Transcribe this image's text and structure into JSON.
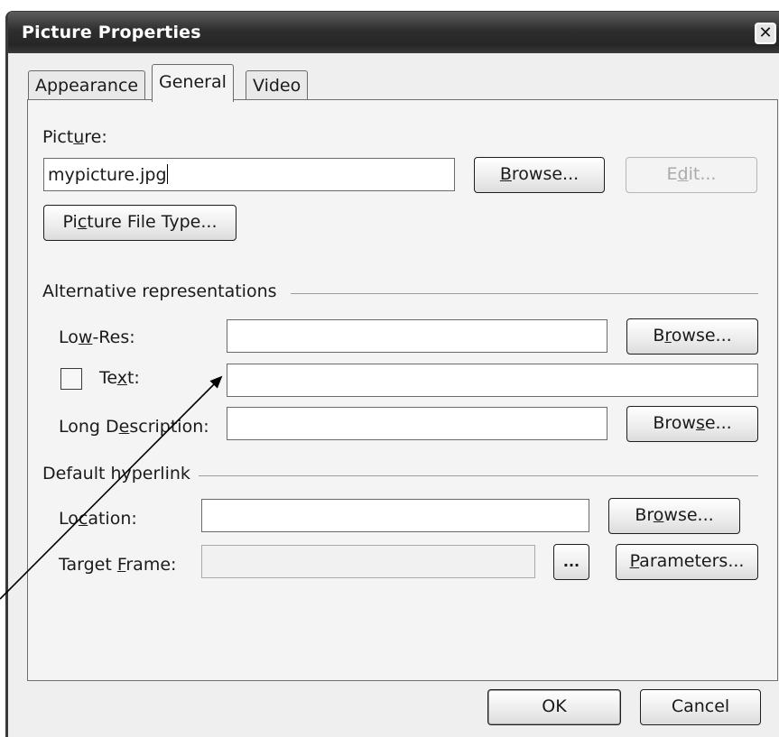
{
  "window": {
    "title": "Picture Properties"
  },
  "tabs": [
    {
      "label": "Appearance"
    },
    {
      "label": "General"
    },
    {
      "label": "Video"
    }
  ],
  "picture": {
    "label_pre": "Pict",
    "label_ul": "u",
    "label_post": "re:",
    "value": "mypicture.jpg",
    "browse_pre": "",
    "browse_ul": "B",
    "browse_post": "rowse...",
    "edit_pre": "E",
    "edit_ul": "d",
    "edit_post": "it...",
    "filetype_pre": "Pi",
    "filetype_ul": "c",
    "filetype_post": "ture File Type..."
  },
  "alt": {
    "heading": "Alternative representations",
    "lowres_pre": "Lo",
    "lowres_ul": "w",
    "lowres_post": "-Res:",
    "lowres_value": "",
    "lowres_browse_pre": "B",
    "lowres_browse_ul": "r",
    "lowres_browse_post": "owse...",
    "text_pre": "Te",
    "text_ul": "x",
    "text_post": "t:",
    "text_checked": false,
    "text_value": "",
    "longdesc_pre": "Long D",
    "longdesc_ul": "e",
    "longdesc_post": "scription:",
    "longdesc_value": "",
    "longdesc_browse_pre": "Brow",
    "longdesc_browse_ul": "s",
    "longdesc_browse_post": "e..."
  },
  "hyperlink": {
    "heading": "Default hyperlink",
    "location_pre": "Lo",
    "location_ul": "c",
    "location_post": "ation:",
    "location_value": "",
    "location_browse_pre": "Br",
    "location_browse_ul": "o",
    "location_browse_post": "wse...",
    "target_pre": "Target ",
    "target_ul": "F",
    "target_post": "rame:",
    "target_value": "",
    "picker_label": "...",
    "params_pre": "",
    "params_ul": "P",
    "params_post": "arameters..."
  },
  "footer": {
    "ok": "OK",
    "cancel": "Cancel"
  },
  "close_glyph": "✕"
}
